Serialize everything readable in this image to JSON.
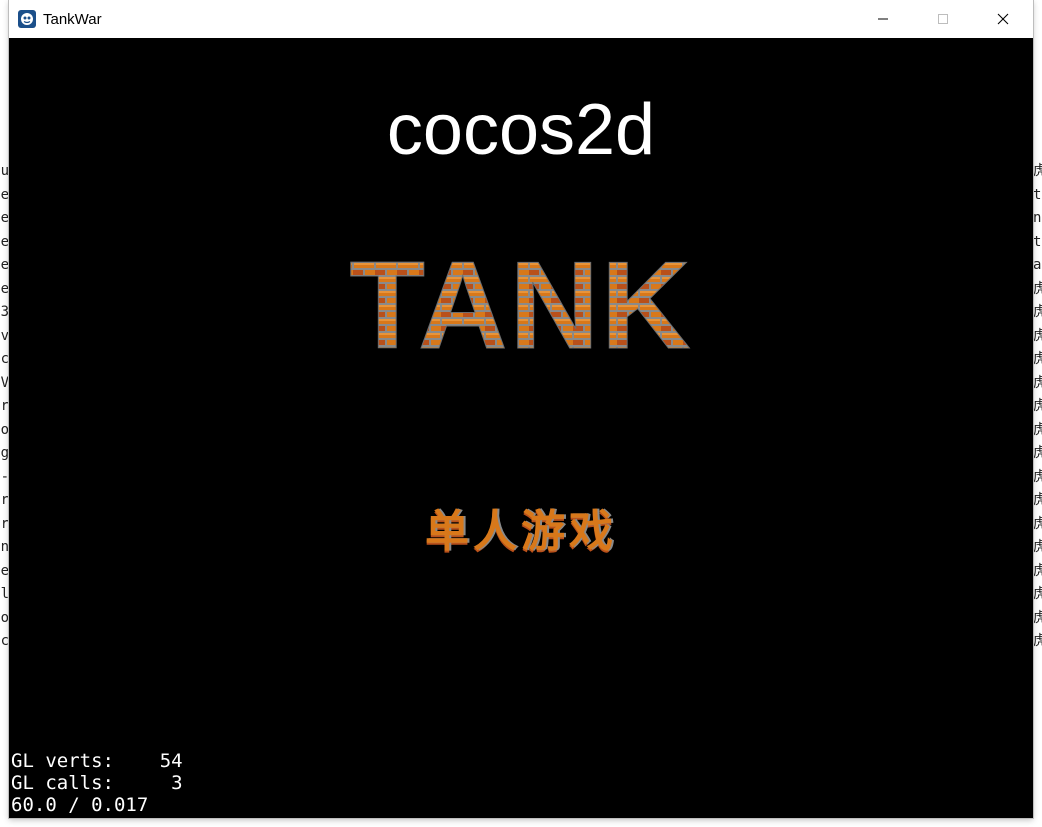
{
  "window": {
    "title": "TankWar",
    "minimize_glyph": "—",
    "maximize_glyph": "☐",
    "close_glyph": "✕"
  },
  "game": {
    "engine_label": "cocos2d",
    "logo_text": "TANK",
    "menu": {
      "single_player": "单人游戏"
    },
    "stats": {
      "gl_verts": "GL verts:    54",
      "gl_calls": "GL calls:     3",
      "fps": "60.0 / 0.017"
    }
  },
  "background": {
    "left_chars": [
      "u",
      "e",
      "e",
      "e",
      "e",
      "e",
      "3",
      "v",
      "c",
      "V",
      "r",
      "o",
      "g",
      "-",
      "r",
      "r",
      "n",
      "e",
      "l",
      "o",
      "c"
    ],
    "right_chars": [
      "虎",
      "ts",
      "ne",
      "t",
      "ar",
      "虎",
      "虎",
      "虎",
      "虎",
      "虎",
      "虎",
      "虎",
      "虎",
      "虎",
      "虎",
      "虎",
      "虎",
      "虎",
      "虎",
      "虎",
      "虎"
    ]
  },
  "colors": {
    "brick_orange": "#d8781a",
    "brick_dark": "#b9501a",
    "mortar_gray": "#8a8a8a",
    "background": "#000000"
  }
}
